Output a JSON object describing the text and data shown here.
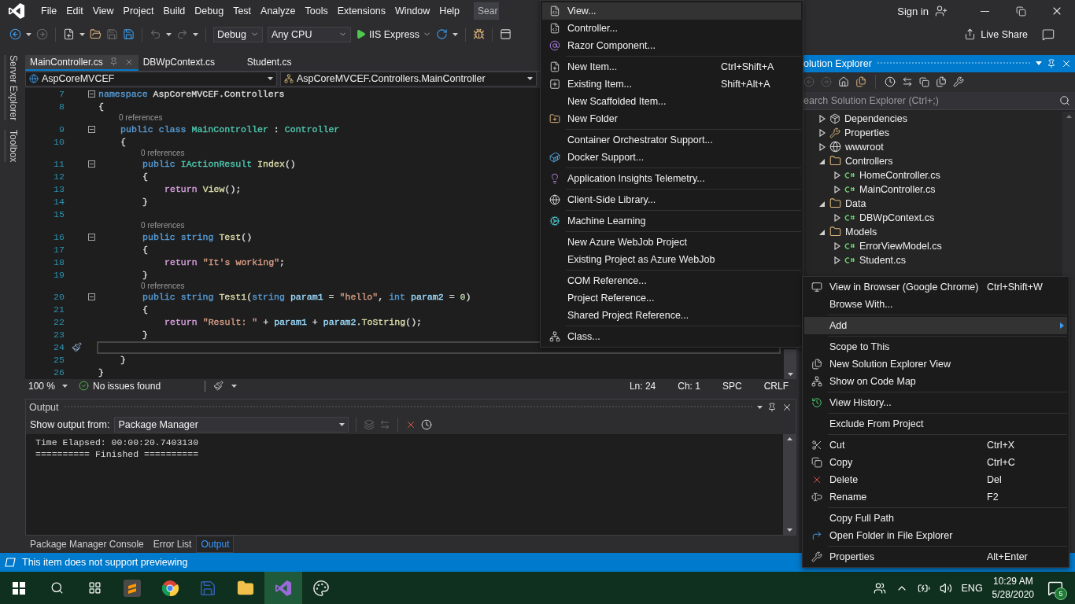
{
  "menu_bar": {
    "items": [
      "File",
      "Edit",
      "View",
      "Project",
      "Build",
      "Debug",
      "Test",
      "Analyze",
      "Tools",
      "Extensions",
      "Window",
      "Help"
    ],
    "search_placeholder": "Sear",
    "sign_in": "Sign in"
  },
  "toolbar": {
    "configuration": "Debug",
    "platform": "Any CPU",
    "run_target": "IIS Express",
    "live_share": "Live Share"
  },
  "side_tabs": [
    "Server Explorer",
    "Toolbox"
  ],
  "doc_tabs": [
    {
      "label": "MainController.cs",
      "selected": true
    },
    {
      "label": "DBWpContext.cs",
      "selected": false
    },
    {
      "label": "Student.cs",
      "selected": false
    }
  ],
  "nav_bar": {
    "project": "AspCoreMVCEF",
    "class": "AspCoreMVCEF.Controllers.MainController"
  },
  "code": [
    {
      "number": "7",
      "foldable": true,
      "current": false,
      "tokens": [
        {
          "text": "namespace ",
          "color": "#569cd6"
        },
        {
          "text": "AspCoreMVCEF.Controllers"
        }
      ]
    },
    {
      "number": "8",
      "foldable": false,
      "current": false,
      "tokens": [
        {
          "text": "{"
        }
      ]
    },
    {
      "number": "9",
      "lens": "0 references",
      "foldable": true,
      "current": false,
      "tokens": [
        {
          "text": "    public class ",
          "color": "#569cd6"
        },
        {
          "text": "MainController",
          "color": "#4ec9b0"
        },
        {
          "text": " : "
        },
        {
          "text": "Controller",
          "color": "#4ec9b0"
        }
      ]
    },
    {
      "number": "10",
      "foldable": false,
      "current": false,
      "tokens": [
        {
          "text": "    {"
        }
      ]
    },
    {
      "number": "11",
      "lens": "0 references",
      "foldable": true,
      "current": false,
      "tokens": [
        {
          "text": "        public ",
          "color": "#569cd6"
        },
        {
          "text": "IActionResult",
          "color": "#4ec9b0"
        },
        {
          "text": " Index",
          "color": "#dcdcaa"
        },
        {
          "text": "()"
        }
      ]
    },
    {
      "number": "12",
      "foldable": false,
      "current": false,
      "tokens": [
        {
          "text": "        {"
        }
      ]
    },
    {
      "number": "13",
      "foldable": false,
      "current": false,
      "tokens": [
        {
          "text": "            return ",
          "color": "#d8a0df"
        },
        {
          "text": "View",
          "color": "#dcdcaa"
        },
        {
          "text": "();"
        }
      ]
    },
    {
      "number": "14",
      "foldable": false,
      "current": false,
      "tokens": [
        {
          "text": "        }"
        }
      ]
    },
    {
      "number": "15",
      "foldable": false,
      "current": false
    },
    {
      "number": "16",
      "lens": "0 references",
      "foldable": true,
      "current": false,
      "tokens": [
        {
          "text": "        public string ",
          "color": "#569cd6"
        },
        {
          "text": "Test",
          "color": "#dcdcaa"
        },
        {
          "text": "()"
        }
      ]
    },
    {
      "number": "17",
      "foldable": false,
      "current": false,
      "tokens": [
        {
          "text": "        {"
        }
      ]
    },
    {
      "number": "18",
      "foldable": false,
      "current": false,
      "tokens": [
        {
          "text": "            return ",
          "color": "#d8a0df"
        },
        {
          "text": "\"It's working\"",
          "color": "#d69d85"
        },
        {
          "text": ";"
        }
      ]
    },
    {
      "number": "19",
      "foldable": false,
      "current": false,
      "tokens": [
        {
          "text": "        }"
        }
      ]
    },
    {
      "number": "20",
      "lens": "0 references",
      "foldable": true,
      "current": false,
      "tokens": [
        {
          "text": "        public string ",
          "color": "#569cd6"
        },
        {
          "text": "Test1",
          "color": "#dcdcaa"
        },
        {
          "text": "("
        },
        {
          "text": "string ",
          "color": "#569cd6"
        },
        {
          "text": "param1",
          "color": "#9cdcfe"
        },
        {
          "text": " = "
        },
        {
          "text": "\"hello\"",
          "color": "#d69d85"
        },
        {
          "text": ", "
        },
        {
          "text": "int ",
          "color": "#569cd6"
        },
        {
          "text": "param2",
          "color": "#9cdcfe"
        },
        {
          "text": " = "
        },
        {
          "text": "0",
          "color": "#b5cea8"
        },
        {
          "text": ")"
        }
      ]
    },
    {
      "number": "21",
      "foldable": false,
      "current": false,
      "tokens": [
        {
          "text": "        {"
        }
      ]
    },
    {
      "number": "22",
      "foldable": false,
      "current": false,
      "tokens": [
        {
          "text": "            return ",
          "color": "#d8a0df"
        },
        {
          "text": "\"Result: \"",
          "color": "#d69d85"
        },
        {
          "text": " + "
        },
        {
          "text": "param1",
          "color": "#9cdcfe"
        },
        {
          "text": " + "
        },
        {
          "text": "param2",
          "color": "#9cdcfe"
        },
        {
          "text": "."
        },
        {
          "text": "ToString",
          "color": "#dcdcaa"
        },
        {
          "text": "();"
        }
      ]
    },
    {
      "number": "23",
      "foldable": false,
      "current": false,
      "tokens": [
        {
          "text": "        }"
        }
      ]
    },
    {
      "number": "24",
      "foldable": false,
      "current": true
    },
    {
      "number": "25",
      "foldable": false,
      "current": false,
      "tokens": [
        {
          "text": "    }"
        }
      ]
    },
    {
      "number": "26",
      "foldable": false,
      "current": false,
      "tokens": [
        {
          "text": "}"
        }
      ]
    }
  ],
  "editor_status": {
    "zoom": "100 %",
    "issues": "No issues found",
    "line": "Ln: 24",
    "column": "Ch: 1",
    "whitespace": "SPC",
    "line_endings": "CRLF"
  },
  "output": {
    "title": "Output",
    "source_label": "Show output from:",
    "source": "Package Manager",
    "lines": [
      "Time Elapsed: 00:00:20.7403130",
      "========== Finished =========="
    ]
  },
  "bottom_tabs": [
    {
      "label": "Package Manager Console",
      "selected": false
    },
    {
      "label": "Error List",
      "selected": false
    },
    {
      "label": "Output",
      "selected": true
    }
  ],
  "status_bar": {
    "message": "This item does not support previewing"
  },
  "solution_explorer": {
    "title": "olution Explorer",
    "search_placeholder": "earch Solution Explorer (Ctrl+;)",
    "tree": [
      {
        "label": "Dependencies",
        "kind": "dependencies",
        "expanded": false
      },
      {
        "label": "Properties",
        "kind": "properties",
        "expanded": false
      },
      {
        "label": "wwwroot",
        "kind": "web",
        "expanded": false
      },
      {
        "label": "Controllers",
        "kind": "folder",
        "expanded": true,
        "children": [
          {
            "label": "HomeController.cs",
            "kind": "code",
            "expanded": false
          },
          {
            "label": "MainController.cs",
            "kind": "code",
            "expanded": false
          }
        ]
      },
      {
        "label": "Data",
        "kind": "folder",
        "expanded": true,
        "children": [
          {
            "label": "DBWpContext.cs",
            "kind": "code",
            "expanded": false
          }
        ]
      },
      {
        "label": "Models",
        "kind": "folder",
        "expanded": true,
        "children": [
          {
            "label": "ErrorViewModel.cs",
            "kind": "code",
            "expanded": false
          },
          {
            "label": "Student.cs",
            "kind": "code",
            "expanded": false
          }
        ]
      }
    ]
  },
  "context_menu": {
    "items": [
      {
        "label": "View in Browser (Google Chrome)",
        "shortcut": "Ctrl+Shift+W",
        "selected": false,
        "separator_before": false,
        "submenu": false
      },
      {
        "label": "Browse With...",
        "selected": false,
        "separator_before": false,
        "submenu": false
      },
      {
        "label": "Add",
        "selected": true,
        "separator_before": true,
        "submenu": true
      },
      {
        "label": "Scope to This",
        "selected": false,
        "separator_before": true,
        "submenu": false
      },
      {
        "label": "New Solution Explorer View",
        "selected": false,
        "separator_before": false,
        "submenu": false
      },
      {
        "label": "Show on Code Map",
        "selected": false,
        "separator_before": false,
        "submenu": false
      },
      {
        "label": "View History...",
        "selected": false,
        "separator_before": true,
        "submenu": false
      },
      {
        "label": "Exclude From Project",
        "selected": false,
        "separator_before": true,
        "submenu": false
      },
      {
        "label": "Cut",
        "shortcut": "Ctrl+X",
        "selected": false,
        "separator_before": true,
        "submenu": false
      },
      {
        "label": "Copy",
        "shortcut": "Ctrl+C",
        "selected": false,
        "separator_before": false,
        "submenu": false
      },
      {
        "label": "Delete",
        "shortcut": "Del",
        "selected": false,
        "separator_before": false,
        "submenu": false
      },
      {
        "label": "Rename",
        "shortcut": "F2",
        "selected": false,
        "separator_before": false,
        "submenu": false
      },
      {
        "label": "Copy Full Path",
        "selected": false,
        "separator_before": true,
        "submenu": false
      },
      {
        "label": "Open Folder in File Explorer",
        "selected": false,
        "separator_before": false,
        "submenu": false
      },
      {
        "label": "Properties",
        "shortcut": "Alt+Enter",
        "selected": false,
        "separator_before": true,
        "submenu": false
      }
    ]
  },
  "add_submenu": {
    "items": [
      {
        "label": "View...",
        "selected": true,
        "separator_before": false,
        "submenu": false
      },
      {
        "label": "Controller...",
        "selected": false,
        "separator_before": false,
        "submenu": false
      },
      {
        "label": "Razor Component...",
        "selected": false,
        "separator_before": false,
        "submenu": false
      },
      {
        "label": "New Item...",
        "shortcut": "Ctrl+Shift+A",
        "selected": false,
        "separator_before": true,
        "submenu": false
      },
      {
        "label": "Existing Item...",
        "shortcut": "Shift+Alt+A",
        "selected": false,
        "separator_before": false,
        "submenu": false
      },
      {
        "label": "New Scaffolded Item...",
        "selected": false,
        "separator_before": false,
        "submenu": false
      },
      {
        "label": "New Folder",
        "selected": false,
        "separator_before": false,
        "submenu": false
      },
      {
        "label": "Container Orchestrator Support...",
        "selected": false,
        "separator_before": true,
        "submenu": false
      },
      {
        "label": "Docker Support...",
        "selected": false,
        "separator_before": false,
        "submenu": false
      },
      {
        "label": "Application Insights Telemetry...",
        "selected": false,
        "separator_before": true,
        "submenu": false
      },
      {
        "label": "Client-Side Library...",
        "selected": false,
        "separator_before": true,
        "submenu": false
      },
      {
        "label": "Machine Learning",
        "selected": false,
        "separator_before": true,
        "submenu": false
      },
      {
        "label": "New Azure WebJob Project",
        "selected": false,
        "separator_before": true,
        "submenu": false
      },
      {
        "label": "Existing Project as Azure WebJob",
        "selected": false,
        "separator_before": false,
        "submenu": false
      },
      {
        "label": "COM Reference...",
        "selected": false,
        "separator_before": true,
        "submenu": false
      },
      {
        "label": "Project Reference...",
        "selected": false,
        "separator_before": false,
        "submenu": false
      },
      {
        "label": "Shared Project Reference...",
        "selected": false,
        "separator_before": false,
        "submenu": false
      },
      {
        "label": "Class...",
        "selected": false,
        "separator_before": true,
        "submenu": false
      }
    ]
  },
  "taskbar": {
    "language": "ENG",
    "time": "10:29 AM",
    "date": "5/28/2020",
    "notifications": "5"
  }
}
